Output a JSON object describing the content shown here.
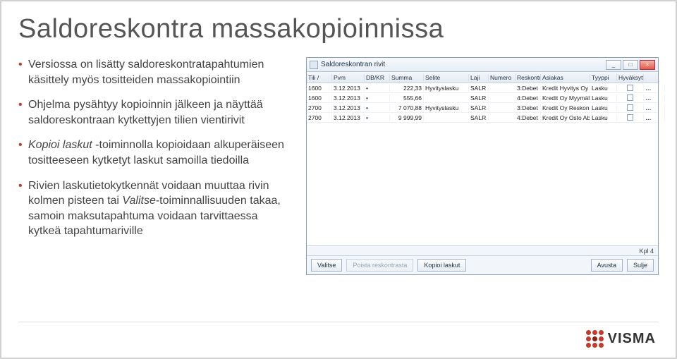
{
  "title": "Saldoreskontra massakopioinnissa",
  "bullets": [
    {
      "plain": "Versiossa on lisätty saldoreskontratapahtumien käsittely myös tositteiden massakopiointiin"
    },
    {
      "plain": "Ohjelma pysähtyy kopioinnin jälkeen ja näyttää saldoreskontraan kytkettyjen tilien vientirivit"
    },
    {
      "lead_em": "Kopioi laskut",
      "rest": " -toiminnolla kopioidaan alkuperäiseen tositteeseen kytketyt laskut samoilla tiedoilla"
    },
    {
      "plain_pre": "Rivien laskutietokytkennät voidaan muuttaa rivin kolmen pisteen tai ",
      "em": "Valitse",
      "plain_post": "-toiminnallisuuden takaa, samoin maksutapahtuma voidaan tarvittaessa kytkeä tapahtumariville"
    }
  ],
  "window": {
    "title": "Saldoreskontran rivit",
    "min": "_",
    "max": "□",
    "close": "×",
    "headers": [
      "Tili /",
      "Pvm",
      "DB/KR",
      "Summa",
      "Selite",
      "Laji",
      "Numero",
      "Reskontra",
      "Asiakas",
      "Tyyppi",
      "Hyväksytty",
      ""
    ],
    "rows": [
      {
        "tili": "1600",
        "pvm": "3.12.2013",
        "summa": "222,33",
        "selite": "Hyvityslasku",
        "laji": "SALR",
        "numero": "",
        "reskontra": "3:Debet",
        "asiakas": "Kredit",
        "extra": "Hyvitys Oy",
        "tyyppi": "Lasku"
      },
      {
        "tili": "1600",
        "pvm": "3.12.2013",
        "summa": "555,66",
        "selite": "",
        "laji": "SALR",
        "numero": "",
        "reskontra": "4:Debet",
        "asiakas": "Kredit",
        "extra": "Oy Myymälä Ab",
        "tyyppi": "Lasku"
      },
      {
        "tili": "2700",
        "pvm": "3.12.2013",
        "summa": "7 070,88",
        "selite": "Hyvityslasku",
        "laji": "SALR",
        "numero": "",
        "reskontra": "3:Debet",
        "asiakas": "Kredit",
        "extra": "Oy Reskontra A",
        "tyyppi": "Lasku"
      },
      {
        "tili": "2700",
        "pvm": "3.12.2013",
        "summa": "9 999,99",
        "selite": "",
        "laji": "SALR",
        "numero": "",
        "reskontra": "4:Debet",
        "asiakas": "Kredit",
        "extra": "Oy Osto Ab",
        "tyyppi": "Lasku"
      }
    ],
    "kpl_label": "Kpl",
    "kpl_value": "4",
    "buttons": {
      "valitse": "Valitse",
      "poista": "Poista reskontrasta",
      "kopioi": "Kopioi laskut",
      "avusta": "Avusta",
      "sulje": "Sulje"
    }
  },
  "logo_text": "VISMA"
}
